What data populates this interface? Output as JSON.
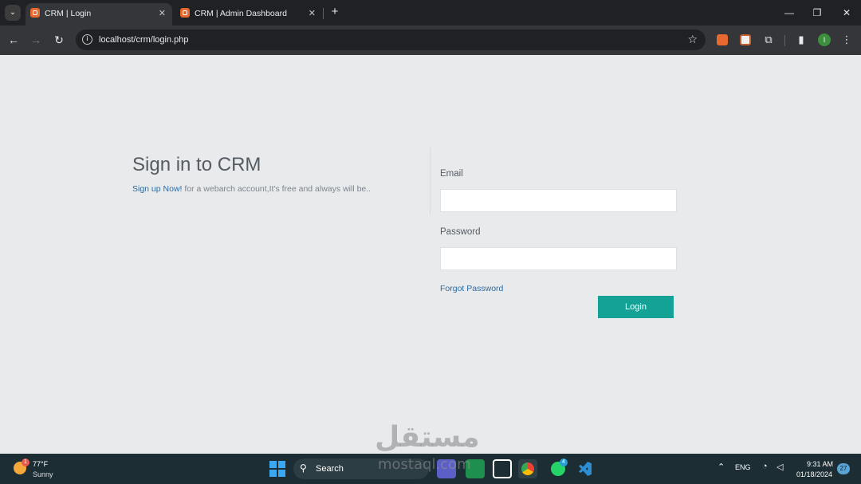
{
  "browser": {
    "tabs": [
      {
        "title": "CRM | Login",
        "active": true
      },
      {
        "title": "CRM | Admin Dashboard",
        "active": false
      }
    ],
    "url": "localhost/crm/login.php",
    "profile_initial": "I"
  },
  "page": {
    "title": "Sign in to CRM",
    "signup_link": "Sign up Now!",
    "signup_text": "for a webarch account,It's free and always will be..",
    "email_label": "Email",
    "email_value": "",
    "password_label": "Password",
    "password_value": "",
    "forgot_link": "Forgot Password",
    "login_button": "Login",
    "accent_color": "#14a296",
    "link_color": "#2c6aa0"
  },
  "watermark": {
    "arabic": "مستقل",
    "latin": "mostaql.com"
  },
  "taskbar": {
    "weather_temp": "77°F",
    "weather_condition": "Sunny",
    "weather_badge": "1",
    "search_label": "Search",
    "whatsapp_badge": "4",
    "language": "ENG",
    "time": "9:31 AM",
    "date": "01/18/2024",
    "notification_count": "27"
  }
}
